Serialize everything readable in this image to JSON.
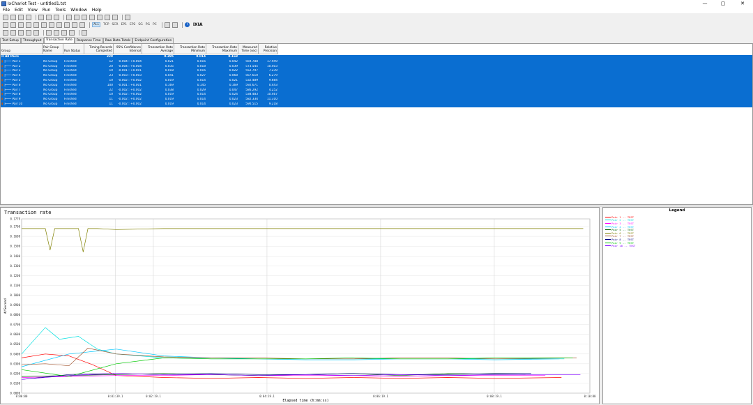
{
  "window": {
    "title": "IxChariot Test - untitled1.tst",
    "min": "—",
    "max": "▢",
    "close": "✕"
  },
  "menu": [
    "File",
    "Edit",
    "View",
    "Run",
    "Tools",
    "Window",
    "Help"
  ],
  "toolbar2": {
    "filters": [
      "ALL",
      "TCP",
      "SCR",
      "EP1",
      "EP2",
      "SG",
      "PG",
      "PC"
    ],
    "brand": "IXIA"
  },
  "tabs": [
    "Test Setup",
    "Throughput",
    "Transaction Rate",
    "Response Time",
    "Raw Data Totals",
    "Endpoint Configuration"
  ],
  "active_tab": "Transaction Rate",
  "table": {
    "headers": [
      "Group",
      "Pair Group Name",
      "Run Status",
      "Timing Records Completed",
      "95% Confidence Interval",
      "Transaction Rate Average",
      "Transaction Rate Minimum",
      "Transaction Rate Maximum",
      "Measured Time (sec)",
      "Relative Precision"
    ],
    "all_row": {
      "name": "All Pairs",
      "records": "229",
      "avg": "0.395",
      "min": "0.014",
      "max": "0.169"
    },
    "rows": [
      {
        "pair": "Pair 1",
        "group": "No Group",
        "status": "Finished",
        "records": "12",
        "ci": "-0.004 : +0.004",
        "avg": "0.021",
        "min": "0.016",
        "max": "0.042",
        "time": "569.788",
        "prec": "17.949"
      },
      {
        "pair": "Pair 2",
        "group": "No Group",
        "status": "Finished",
        "records": "20",
        "ci": "-0.004 : +0.004",
        "avg": "0.035",
        "min": "0.018",
        "max": "0.039",
        "time": "573.545",
        "prec": "10.403"
      },
      {
        "pair": "Pair 3",
        "group": "No Group",
        "status": "Finished",
        "records": "10",
        "ci": "-0.001 : +0.001",
        "avg": "0.018",
        "min": "0.016",
        "max": "0.022",
        "time": "552.797",
        "prec": "7.239"
      },
      {
        "pair": "Pair 4",
        "group": "No Group",
        "status": "Finished",
        "records": "23",
        "ci": "-0.003 : +0.003",
        "avg": "0.041",
        "min": "0.027",
        "max": "0.068",
        "time": "567.610",
        "prec": "6.279"
      },
      {
        "pair": "Pair 5",
        "group": "No Group",
        "status": "Finished",
        "records": "10",
        "ci": "-0.002 : +0.002",
        "avg": "0.019",
        "min": "0.014",
        "max": "0.021",
        "time": "532.489",
        "prec": "9.684"
      },
      {
        "pair": "Pair 6",
        "group": "No Group",
        "status": "Finished",
        "records": "100",
        "ci": "-0.001 : +0.001",
        "avg": "0.169",
        "min": "0.145",
        "max": "0.169",
        "time": "592.671",
        "prec": "0.443"
      },
      {
        "pair": "Pair 7",
        "group": "No Group",
        "status": "Finished",
        "records": "22",
        "ci": "-0.002 : +0.002",
        "avg": "0.038",
        "min": "0.029",
        "max": "0.047",
        "time": "586.292",
        "prec": "4.252"
      },
      {
        "pair": "Pair 8",
        "group": "No Group",
        "status": "Finished",
        "records": "10",
        "ci": "-0.002 : +0.002",
        "avg": "0.019",
        "min": "0.014",
        "max": "0.024",
        "time": "538.483",
        "prec": "10.467"
      },
      {
        "pair": "Pair 9",
        "group": "No Group",
        "status": "Finished",
        "records": "11",
        "ci": "-0.002 : +0.002",
        "avg": "0.019",
        "min": "0.014",
        "max": "0.023",
        "time": "582.334",
        "prec": "11.310"
      },
      {
        "pair": "Pair 10",
        "group": "No Group",
        "status": "Finished",
        "records": "11",
        "ci": "-0.002 : +0.002",
        "avg": "0.019",
        "min": "0.014",
        "max": "0.023",
        "time": "590.515",
        "prec": "9.218"
      }
    ]
  },
  "legend": {
    "title": "Legend",
    "items": [
      {
        "label": "Pair 1 -- TEST",
        "color": "#ff0000"
      },
      {
        "label": "Pair 2 -- TEST",
        "color": "#00e0e0"
      },
      {
        "label": "Pair 3 -- TEST",
        "color": "#ff00ff"
      },
      {
        "label": "Pair 4 -- TEST",
        "color": "#00c8ff"
      },
      {
        "label": "Pair 5 -- TEST",
        "color": "#006400"
      },
      {
        "label": "Pair 6 -- TEST",
        "color": "#808000"
      },
      {
        "label": "Pair 7 -- TEST",
        "color": "#a0522d"
      },
      {
        "label": "Pair 8 -- TEST",
        "color": "#000080"
      },
      {
        "label": "Pair 9 -- TEST",
        "color": "#00c800"
      },
      {
        "label": "Pair 10 -- TEST",
        "color": "#8000ff"
      }
    ]
  },
  "chart_data": {
    "type": "line",
    "title": "Transaction rate",
    "xlabel": "Elapsed time (h:mm:ss)",
    "ylabel": "#/Second",
    "ylim": [
      0,
      0.1779
    ],
    "xlim_seconds": [
      0,
      600
    ],
    "x_ticks": [
      "0:00:00",
      "0:01:39.1",
      "0:02:19.1",
      "0:04:19.1",
      "0:06:19.1",
      "0:08:19.1",
      "0:10:00"
    ],
    "y_ticks": [
      "0.0000",
      "0.0100",
      "0.0200",
      "0.0300",
      "0.0400",
      "0.0500",
      "0.0600",
      "0.0700",
      "0.0800",
      "0.0900",
      "0.1000",
      "0.1100",
      "0.1200",
      "0.1300",
      "0.1400",
      "0.1500",
      "0.1600",
      "0.1700",
      "0.1779"
    ],
    "grid": true,
    "series": [
      {
        "name": "Pair 1 -- TEST",
        "color": "#ff0000",
        "x": [
          0,
          25,
          50,
          75,
          100,
          150,
          200,
          250,
          300,
          350,
          400,
          450,
          500,
          570
        ],
        "y": [
          0.036,
          0.04,
          0.038,
          0.029,
          0.018,
          0.016,
          0.015,
          0.016,
          0.015,
          0.016,
          0.015,
          0.016,
          0.015,
          0.016
        ]
      },
      {
        "name": "Pair 2 -- TEST",
        "color": "#00e0e0",
        "x": [
          0,
          25,
          40,
          60,
          80,
          100,
          150,
          200,
          250,
          300,
          350,
          400,
          450,
          500,
          573
        ],
        "y": [
          0.04,
          0.067,
          0.055,
          0.058,
          0.045,
          0.04,
          0.036,
          0.035,
          0.035,
          0.035,
          0.035,
          0.035,
          0.035,
          0.035,
          0.035
        ]
      },
      {
        "name": "Pair 3 -- TEST",
        "color": "#ff00ff",
        "x": [
          0,
          50,
          100,
          150,
          200,
          250,
          300,
          350,
          400,
          450,
          500,
          553
        ],
        "y": [
          0.016,
          0.017,
          0.018,
          0.018,
          0.019,
          0.018,
          0.018,
          0.018,
          0.017,
          0.018,
          0.018,
          0.018
        ]
      },
      {
        "name": "Pair 4 -- TEST",
        "color": "#00c8ff",
        "x": [
          0,
          50,
          100,
          150,
          200,
          250,
          300,
          350,
          400,
          450,
          500,
          568
        ],
        "y": [
          0.027,
          0.04,
          0.045,
          0.038,
          0.036,
          0.035,
          0.034,
          0.034,
          0.035,
          0.035,
          0.034,
          0.035
        ]
      },
      {
        "name": "Pair 5 -- TEST",
        "color": "#006400",
        "x": [
          0,
          50,
          100,
          150,
          200,
          250,
          300,
          350,
          400,
          450,
          532
        ],
        "y": [
          0.017,
          0.018,
          0.019,
          0.02,
          0.019,
          0.018,
          0.019,
          0.02,
          0.018,
          0.02,
          0.019
        ]
      },
      {
        "name": "Pair 6 -- TEST",
        "color": "#808000",
        "x": [
          0,
          15,
          25,
          30,
          35,
          50,
          60,
          65,
          70,
          80,
          100,
          150,
          200,
          300,
          400,
          500,
          593
        ],
        "y": [
          0.168,
          0.168,
          0.168,
          0.146,
          0.168,
          0.168,
          0.168,
          0.144,
          0.168,
          0.168,
          0.167,
          0.168,
          0.168,
          0.168,
          0.168,
          0.168,
          0.168
        ]
      },
      {
        "name": "Pair 7 -- TEST",
        "color": "#a0522d",
        "x": [
          0,
          25,
          50,
          70,
          100,
          150,
          200,
          250,
          300,
          350,
          400,
          450,
          500,
          586
        ],
        "y": [
          0.029,
          0.03,
          0.028,
          0.046,
          0.04,
          0.037,
          0.036,
          0.036,
          0.035,
          0.035,
          0.036,
          0.036,
          0.035,
          0.036
        ]
      },
      {
        "name": "Pair 8 -- TEST",
        "color": "#000080",
        "x": [
          0,
          50,
          100,
          150,
          200,
          250,
          300,
          350,
          400,
          450,
          500,
          538
        ],
        "y": [
          0.014,
          0.019,
          0.02,
          0.019,
          0.02,
          0.019,
          0.019,
          0.02,
          0.019,
          0.019,
          0.02,
          0.02
        ]
      },
      {
        "name": "Pair 9 -- TEST",
        "color": "#00c800",
        "x": [
          0,
          50,
          100,
          150,
          200,
          250,
          300,
          350,
          400,
          450,
          500,
          582
        ],
        "y": [
          0.024,
          0.017,
          0.03,
          0.036,
          0.035,
          0.035,
          0.035,
          0.036,
          0.035,
          0.035,
          0.036,
          0.036
        ]
      },
      {
        "name": "Pair 10 -- TEST",
        "color": "#8000ff",
        "x": [
          0,
          50,
          100,
          150,
          200,
          250,
          300,
          350,
          400,
          450,
          500,
          590
        ],
        "y": [
          0.014,
          0.018,
          0.02,
          0.019,
          0.019,
          0.018,
          0.019,
          0.018,
          0.019,
          0.018,
          0.019,
          0.019
        ]
      }
    ]
  }
}
